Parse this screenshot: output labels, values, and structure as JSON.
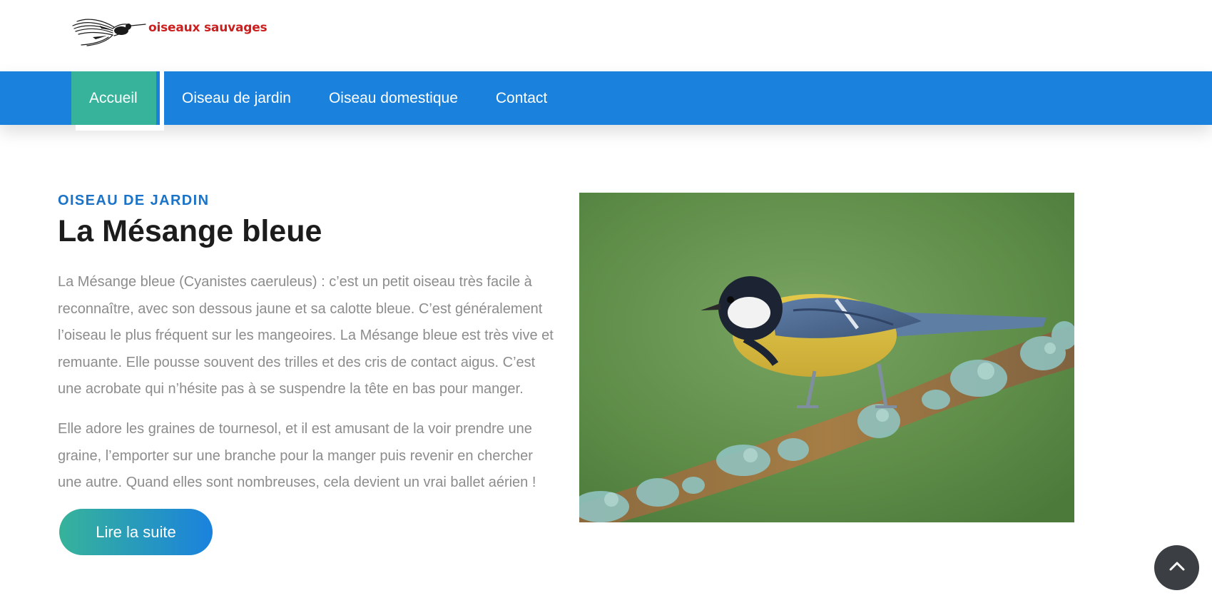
{
  "brand": {
    "name": "oiseaux sauvages",
    "logo_icon": "hummingbird-icon",
    "color": "#cc1f1f"
  },
  "nav": {
    "items": [
      {
        "label": "Accueil",
        "active": true
      },
      {
        "label": "Oiseau de jardin",
        "active": false
      },
      {
        "label": "Oiseau domestique",
        "active": false
      },
      {
        "label": "Contact",
        "active": false
      }
    ]
  },
  "article": {
    "kicker": "OISEAU DE JARDIN",
    "title": "La Mésange bleue",
    "paragraphs": [
      "La Mésange bleue (Cyanistes caeruleus) : c’est un petit oiseau très facile à reconnaître, avec son dessous jaune et sa calotte bleue. C’est généralement l’oiseau le plus fréquent sur les mangeoires. La Mésange bleue est très vive et remuante. Elle pousse souvent des trilles et des cris de contact aigus. C’est une acrobate qui n’hésite pas à se suspendre la tête en bas pour manger.",
      "Elle adore les graines de tournesol, et il est amusant de la voir prendre une graine, l’emporter sur une branche pour la manger puis revenir en chercher une autre. Quand elles sont nombreuses, cela devient un vrai ballet aérien !"
    ],
    "button_label": "Lire la suite",
    "image_icon": "bird-on-branch-photo"
  },
  "back_to_top_icon": "chevron-up-icon",
  "colors": {
    "nav_bg": "#1a82dd",
    "nav_active": "#36b39a",
    "kicker": "#1a73c8",
    "body_text": "#8c8c8c",
    "back_to_top_bg": "#3b3e42"
  }
}
